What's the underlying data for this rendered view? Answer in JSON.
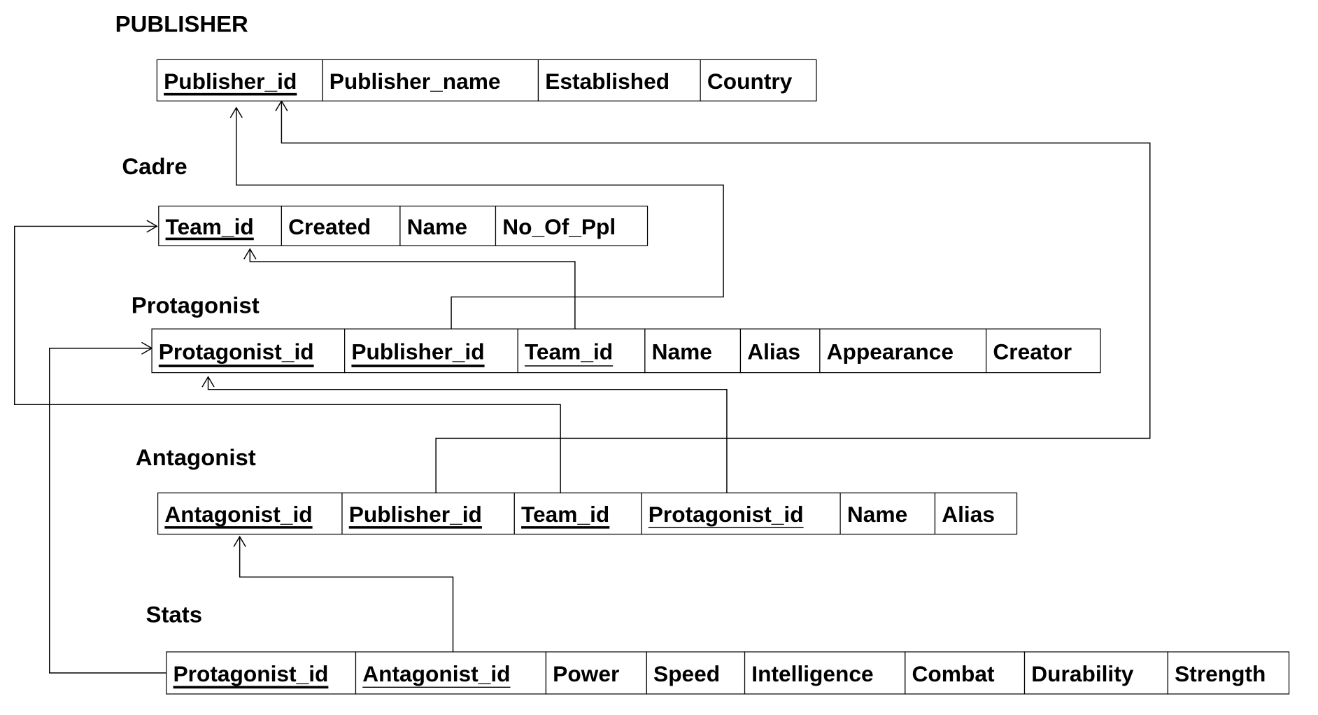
{
  "tables": [
    {
      "title": "PUBLISHER",
      "columns": [
        {
          "name": "Publisher_id",
          "key": "primary"
        },
        {
          "name": "Publisher_name"
        },
        {
          "name": "Established"
        },
        {
          "name": "Country"
        }
      ]
    },
    {
      "title": "Cadre",
      "columns": [
        {
          "name": "Team_id",
          "key": "primary"
        },
        {
          "name": "Created"
        },
        {
          "name": "Name"
        },
        {
          "name": "No_Of_Ppl"
        }
      ]
    },
    {
      "title": "Protagonist",
      "columns": [
        {
          "name": "Protagonist_id",
          "key": "primary"
        },
        {
          "name": "Publisher_id",
          "key": "primary"
        },
        {
          "name": "Team_id",
          "key": "foreign"
        },
        {
          "name": "Name"
        },
        {
          "name": "Alias"
        },
        {
          "name": "Appearance"
        },
        {
          "name": "Creator"
        }
      ]
    },
    {
      "title": "Antagonist",
      "columns": [
        {
          "name": "Antagonist_id",
          "key": "primary"
        },
        {
          "name": "Publisher_id",
          "key": "primary"
        },
        {
          "name": "Team_id",
          "key": "primary"
        },
        {
          "name": "Protagonist_id",
          "key": "foreign"
        },
        {
          "name": "Name"
        },
        {
          "name": "Alias"
        }
      ]
    },
    {
      "title": "Stats",
      "columns": [
        {
          "name": "Protagonist_id",
          "key": "primary"
        },
        {
          "name": "Antagonist_id",
          "key": "foreign"
        },
        {
          "name": "Power"
        },
        {
          "name": "Speed"
        },
        {
          "name": "Intelligence"
        },
        {
          "name": "Combat"
        },
        {
          "name": "Durability"
        },
        {
          "name": "Strength"
        }
      ]
    }
  ],
  "relationships": [
    {
      "from": "Protagonist.Publisher_id",
      "to": "PUBLISHER.Publisher_id"
    },
    {
      "from": "Antagonist.Publisher_id",
      "to": "PUBLISHER.Publisher_id"
    },
    {
      "from": "Protagonist.Team_id",
      "to": "Cadre.Team_id"
    },
    {
      "from": "Antagonist.Team_id",
      "to": "Cadre.Team_id"
    },
    {
      "from": "Antagonist.Protagonist_id",
      "to": "Protagonist.Protagonist_id"
    },
    {
      "from": "Stats.Antagonist_id",
      "to": "Antagonist.Antagonist_id"
    },
    {
      "from": "Stats.Protagonist_id",
      "to": "Protagonist.Protagonist_id"
    }
  ]
}
